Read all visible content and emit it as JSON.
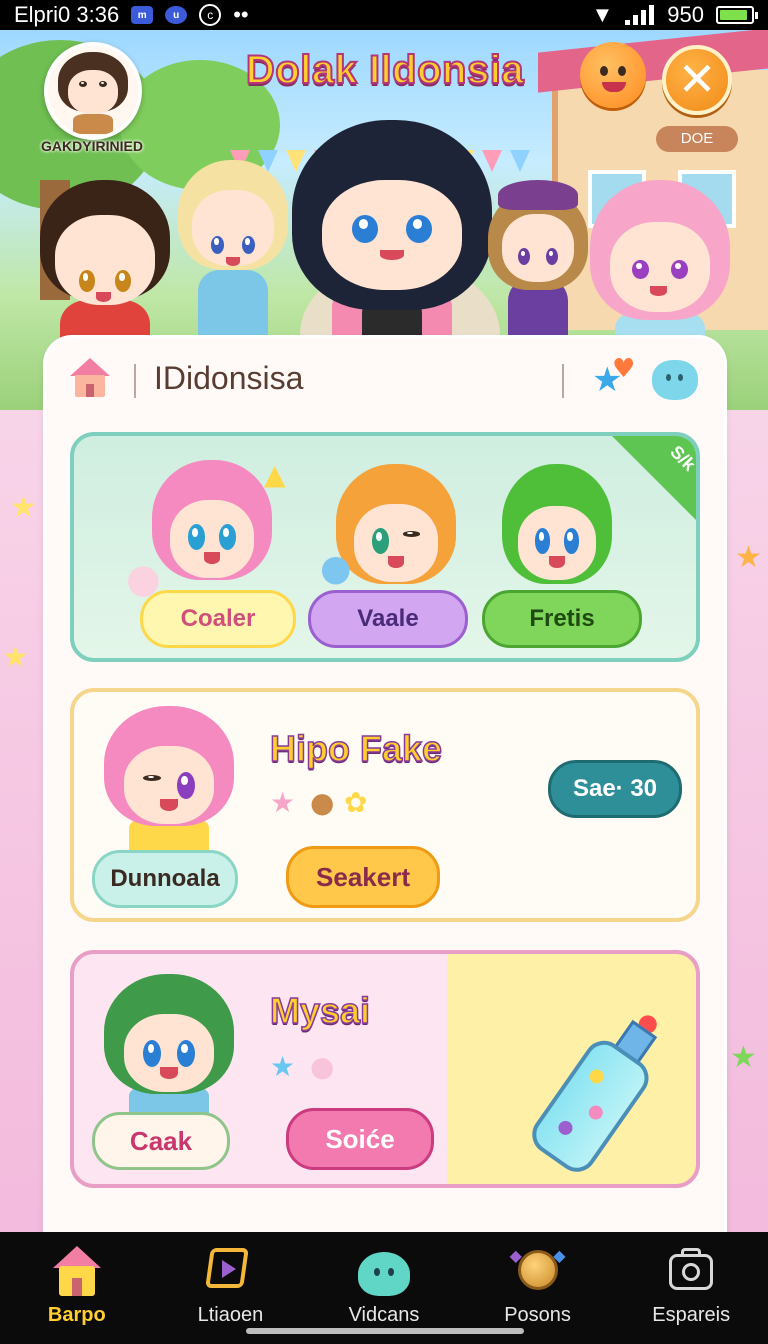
{
  "status_bar": {
    "carrier_time": "Elpri0 3:36",
    "right_text": "950"
  },
  "header": {
    "title": "Dolak Ildonsia",
    "avatar_name": "GAKDYIRINIED",
    "done_label": "DOE",
    "close_symbol": "✕"
  },
  "panel": {
    "title": "IDidonsisa"
  },
  "card1": {
    "ribbon": "S/k",
    "buttons": [
      "Coaler",
      "Vaale",
      "Fretis"
    ]
  },
  "card2": {
    "title": "Hipo Fake",
    "badge": "Sae· 30",
    "buttons": [
      "Dunnoala",
      "Seakert"
    ]
  },
  "card3": {
    "title": "Mysai",
    "buttons": [
      "Caak",
      "Soiće"
    ]
  },
  "nav": {
    "items": [
      {
        "label": "Barpo",
        "icon": "house-icon"
      },
      {
        "label": "Ltiaoen",
        "icon": "play-icon"
      },
      {
        "label": "Vidcans",
        "icon": "slime-icon"
      },
      {
        "label": "Posons",
        "icon": "gem-icon"
      },
      {
        "label": "Espareis",
        "icon": "camera-icon"
      }
    ],
    "active_index": 0
  },
  "colors": {
    "accent": "#ffcf2e",
    "panel_bg": "#fffaf8",
    "nav_bg": "#0b0b0b"
  }
}
